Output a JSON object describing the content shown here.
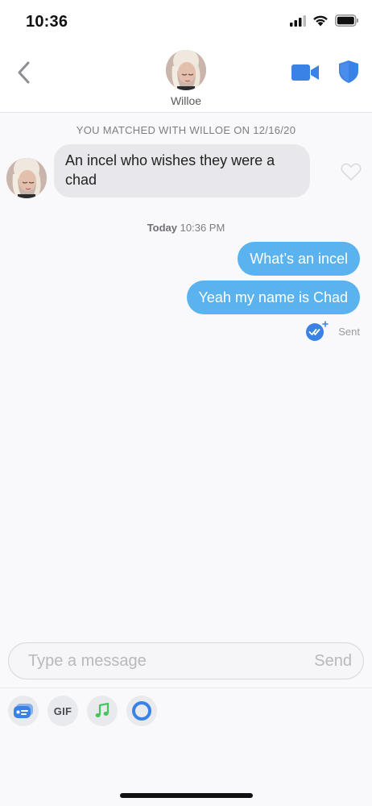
{
  "status_bar": {
    "time": "10:36"
  },
  "header": {
    "name": "Willoe"
  },
  "match_notice": "YOU MATCHED WITH WILLOE ON 12/16/20",
  "messages": {
    "incoming": [
      "An incel who wishes they were a chad"
    ],
    "day_label": "Today",
    "time_label": "10:36 PM",
    "outgoing": [
      "What’s an incel",
      "Yeah my name is Chad"
    ],
    "status": "Sent"
  },
  "composer": {
    "placeholder": "Type a message",
    "send_label": "Send"
  },
  "toolbar": {
    "gif_label": "GIF"
  },
  "icons": {
    "status": [
      "signal-icon",
      "wifi-icon",
      "battery-icon"
    ],
    "header": [
      "back-chevron-icon",
      "video-call-icon",
      "shield-icon"
    ],
    "message": [
      "heart-outline-icon",
      "read-receipt-icon"
    ],
    "toolbar": [
      "contact-card-icon",
      "gif-icon",
      "music-note-icon",
      "ring-icon"
    ]
  },
  "colors": {
    "accent_blue": "#3b82e6",
    "outgoing_bubble": "#5ab3ee",
    "incoming_bubble": "#e8e8ec",
    "music_green": "#46c35a"
  }
}
